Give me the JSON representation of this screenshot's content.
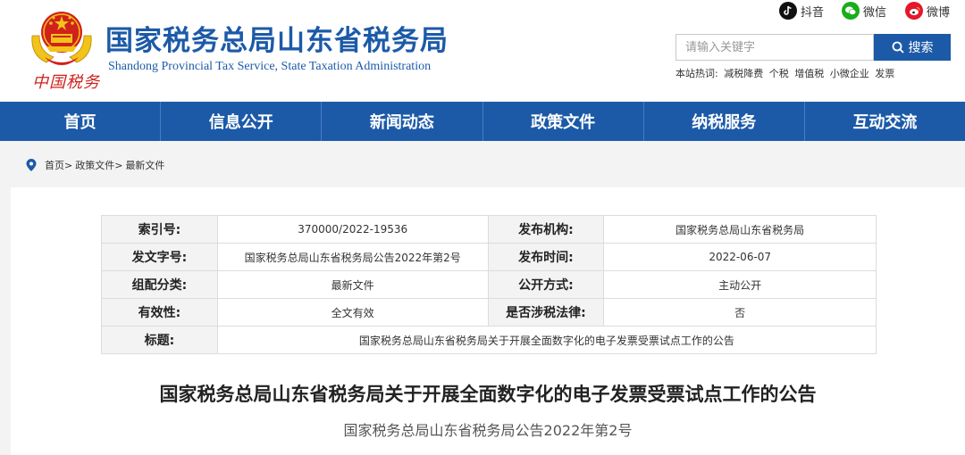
{
  "header": {
    "logo_text": "中国税务",
    "site_title": "国家税务总局山东省税务局",
    "site_subtitle": "Shandong Provincial Tax Service, State Taxation Administration",
    "social": [
      {
        "icon": "douyin-icon",
        "label": "抖音"
      },
      {
        "icon": "wechat-icon",
        "label": "微信"
      },
      {
        "icon": "weibo-icon",
        "label": "微博"
      }
    ],
    "search": {
      "placeholder": "请输入关键字",
      "button_label": "搜索"
    },
    "hotwords": {
      "label": "本站热词:",
      "items": [
        "减税降费",
        "个税",
        "增值税",
        "小微企业",
        "发票"
      ]
    }
  },
  "nav": {
    "items": [
      "首页",
      "信息公开",
      "新闻动态",
      "政策文件",
      "纳税服务",
      "互动交流"
    ]
  },
  "breadcrumb": {
    "items": [
      "首页>",
      "政策文件>",
      "最新文件"
    ]
  },
  "meta_table": {
    "rows": [
      {
        "k1": "索引号:",
        "v1": "370000/2022-19536",
        "k2": "发布机构:",
        "v2": "国家税务总局山东省税务局"
      },
      {
        "k1": "发文字号:",
        "v1": "国家税务总局山东省税务局公告2022年第2号",
        "k2": "发布时间:",
        "v2": "2022-06-07"
      },
      {
        "k1": "组配分类:",
        "v1": "最新文件",
        "k2": "公开方式:",
        "v2": "主动公开"
      },
      {
        "k1": "有效性:",
        "v1": "全文有效",
        "k2": "是否涉税法律:",
        "v2": "否"
      }
    ],
    "title_row": {
      "k": "标题:",
      "v": "国家税务总局山东省税务局关于开展全面数字化的电子发票受票试点工作的公告"
    }
  },
  "article": {
    "title": "国家税务总局山东省税务局关于开展全面数字化的电子发票受票试点工作的公告",
    "doc_number": "国家税务总局山东省税务局公告2022年第2号"
  },
  "colors": {
    "brand_blue": "#1c5aa8",
    "emblem_red": "#d0211c",
    "emblem_gold": "#f2c318"
  }
}
